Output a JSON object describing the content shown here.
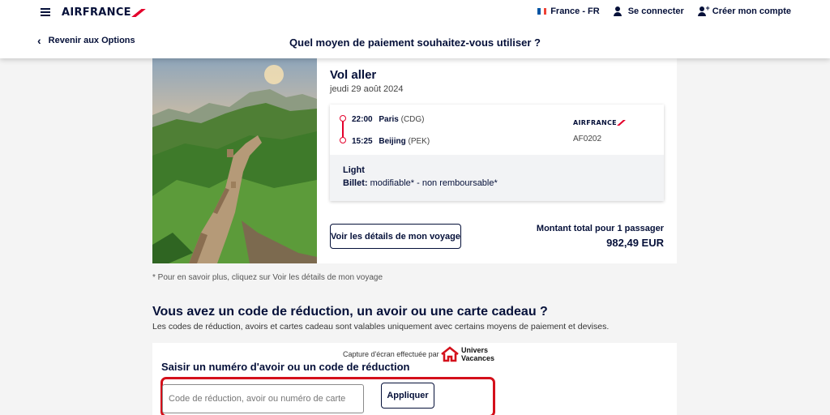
{
  "colors": {
    "brand_navy": "#051039",
    "brand_red": "#e4002b",
    "highlight_red": "#d4101b",
    "page_bg": "#f4f4f4"
  },
  "header": {
    "menu_icon": "hamburger-menu-icon",
    "logo_text": "AIRFRANCE",
    "country": "France - FR",
    "login": "Se connecter",
    "create_account": "Créer mon compte",
    "back_label": "Revenir aux Options",
    "title": "Quel moyen de paiement souhaitez-vous utiliser ?"
  },
  "flight": {
    "title": "Vol aller",
    "date": "jeudi 29 août 2024",
    "departure": {
      "time": "22:00",
      "city": "Paris",
      "code": "(CDG)"
    },
    "arrival": {
      "time": "15:25",
      "city": "Beijing",
      "code": "(PEK)"
    },
    "airline_logo": "AIRFRANCE",
    "flight_number": "AF0202",
    "fare_name": "Light",
    "ticket_label": "Billet:",
    "ticket_conditions": "modifiable* - non remboursable*",
    "details_button": "Voir les détails de mon voyage",
    "total_label": "Montant total pour 1 passager",
    "total_price": "982,49 EUR"
  },
  "footnote": "* Pour en savoir plus, cliquez sur Voir les détails de mon voyage",
  "discount": {
    "title": "Vous avez un code de réduction, un avoir ou une carte cadeau ?",
    "subtitle": "Les codes de réduction, avoirs et cartes cadeau sont valables uniquement avec certains moyens de paiement et devises.",
    "capture_credit": "Capture d'écran effectuée par",
    "capture_logo_line1": "Univers",
    "capture_logo_line2": "Vacances",
    "field_label": "Saisir un numéro d'avoir ou un code de réduction",
    "input_value": "",
    "input_placeholder": "Code de réduction, avoir ou numéro de carte",
    "apply_button": "Appliquer"
  }
}
